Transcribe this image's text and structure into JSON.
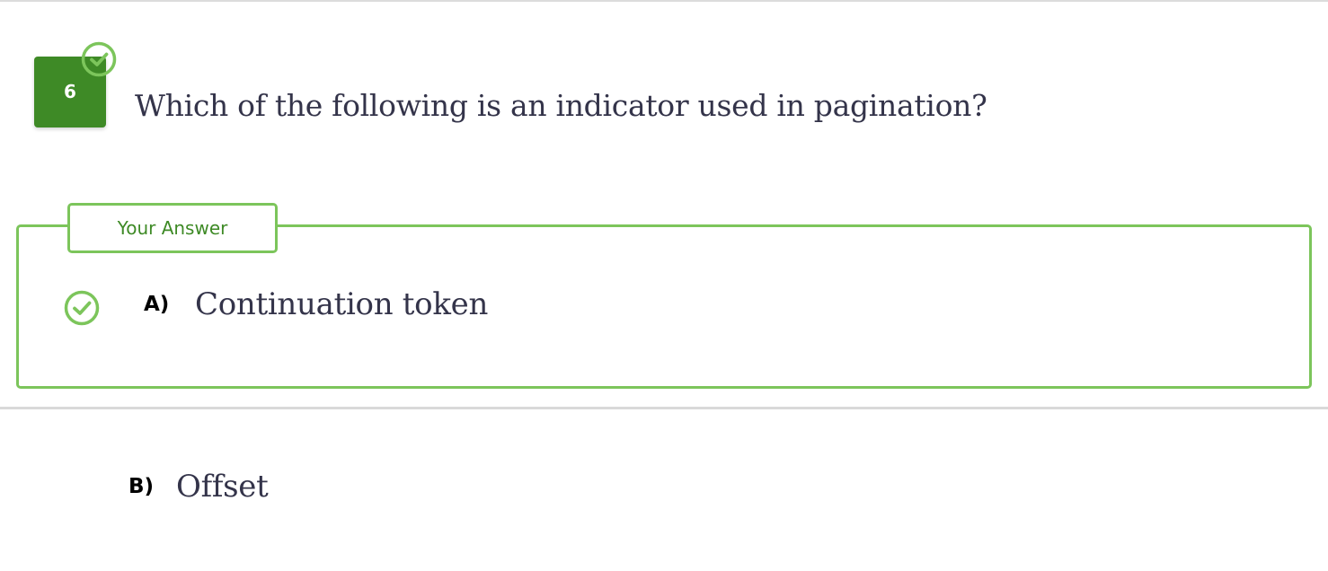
{
  "question": {
    "number": "6",
    "text": "Which of the following is an indicator used in pagination?",
    "status": "answered-correct"
  },
  "your_answer": {
    "tag_label": "Your Answer",
    "option": {
      "letter": "A)",
      "text": "Continuation token",
      "state_icon": "check-circle-icon"
    }
  },
  "other_options": [
    {
      "letter": "B)",
      "text": "Offset"
    }
  ],
  "colors": {
    "badge_green": "#3e8a26",
    "accent_green": "#7cc55b",
    "text_dark": "#34344a"
  }
}
